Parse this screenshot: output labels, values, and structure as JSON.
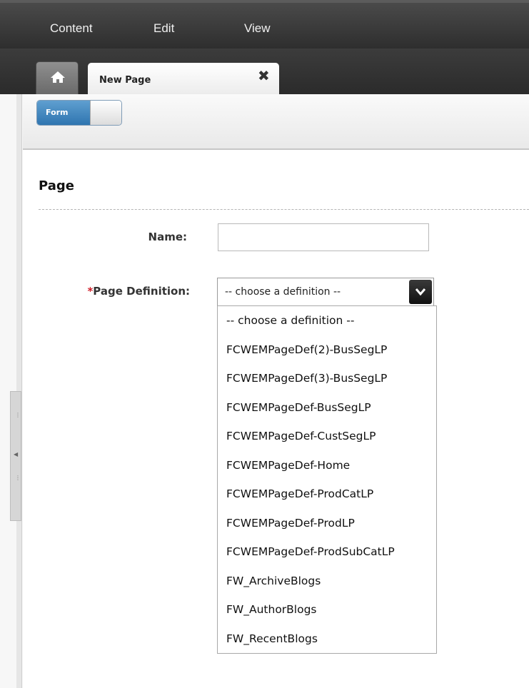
{
  "menubar": {
    "items": [
      "Content",
      "Edit",
      "View"
    ]
  },
  "tabs": {
    "home_icon": "home-icon",
    "active_tab_label": "New Page",
    "close_glyph": "✖"
  },
  "toolbar": {
    "form_toggle_label": "Form",
    "form_toggle_on": true
  },
  "form": {
    "section_title": "Page",
    "name_label": "Name:",
    "name_value": "",
    "page_definition_required_mark": "*",
    "page_definition_label": "Page Definition:",
    "page_definition_selected": "-- choose a definition --",
    "page_definition_options": [
      "-- choose a definition --",
      "FCWEMPageDef(2)-BusSegLP",
      "FCWEMPageDef(3)-BusSegLP",
      "FCWEMPageDef-BusSegLP",
      "FCWEMPageDef-CustSegLP",
      "FCWEMPageDef-Home",
      "FCWEMPageDef-ProdCatLP",
      "FCWEMPageDef-ProdLP",
      "FCWEMPageDef-ProdSubCatLP",
      "FW_ArchiveBlogs",
      "FW_AuthorBlogs",
      "FW_RecentBlogs"
    ]
  },
  "colors": {
    "menubar_bg": "#3a3a3a",
    "toggle_blue": "#3b83bd",
    "required_red": "#d0202a"
  }
}
